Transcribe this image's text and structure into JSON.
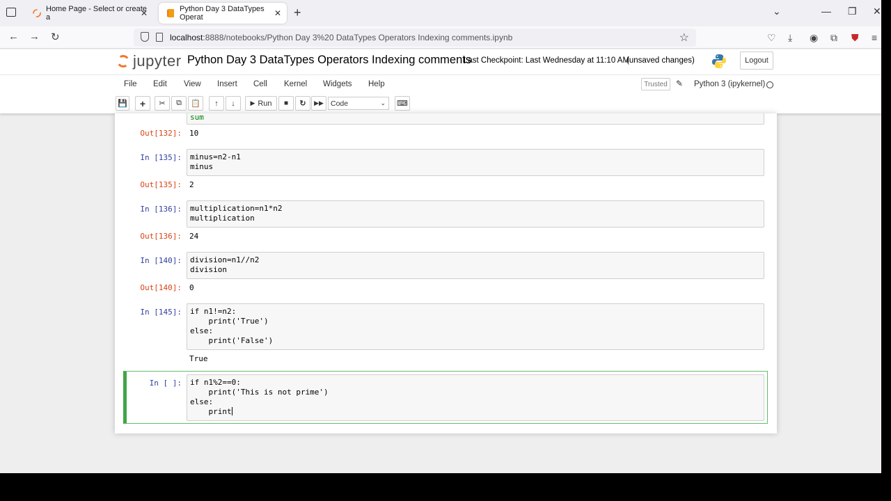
{
  "browser": {
    "tabs": [
      {
        "title": "Home Page - Select or create a",
        "active": false
      },
      {
        "title": "Python Day 3 DataTypes Operat",
        "active": true
      }
    ],
    "url_host": "localhost",
    "url_rest": ":8888/notebooks/Python Day 3%20 DataTypes Operators Indexing comments.ipynb"
  },
  "jupyter": {
    "logo_text": "jupyter",
    "notebook_title": "Python Day 3 DataTypes Operators Indexing comments",
    "checkpoint": "Last Checkpoint: Last Wednesday at 11:10 AM",
    "unsaved": "(unsaved changes)",
    "logout_label": "Logout",
    "menus": [
      "File",
      "Edit",
      "View",
      "Insert",
      "Cell",
      "Kernel",
      "Widgets",
      "Help"
    ],
    "trusted_label": "Trusted",
    "kernel_name": "Python 3 (ipykernel)",
    "toolbar": {
      "run_label": "Run",
      "cell_type": "Code"
    }
  },
  "cells": [
    {
      "out_prompt": "Out[132]:",
      "partial_code": "sum",
      "output": "10"
    },
    {
      "in_prompt": "In [135]:",
      "out_prompt": "Out[135]:",
      "code": [
        "minus=n2-n1",
        "minus"
      ],
      "output": "2"
    },
    {
      "in_prompt": "In [136]:",
      "out_prompt": "Out[136]:",
      "code": [
        "multiplication=n1*n2",
        "multiplication"
      ],
      "output": "24"
    },
    {
      "in_prompt": "In [140]:",
      "out_prompt": "Out[140]:",
      "code": [
        "division=n1//n2",
        "division"
      ],
      "output": "0"
    },
    {
      "in_prompt": "In [145]:",
      "code": [
        "if n1!=n2:",
        "    print('True')",
        "else:",
        "    print('False')"
      ],
      "output": "True"
    },
    {
      "in_prompt": "In [ ]:",
      "code": [
        "if n1%2==0:",
        "    print('This is not prime')",
        "else:",
        "    print"
      ]
    }
  ],
  "colors": {
    "in_prompt": "#303f9f",
    "out_prompt": "#d84315",
    "active_cell_border": "#42a547",
    "jupyter_orange": "#f37726"
  }
}
